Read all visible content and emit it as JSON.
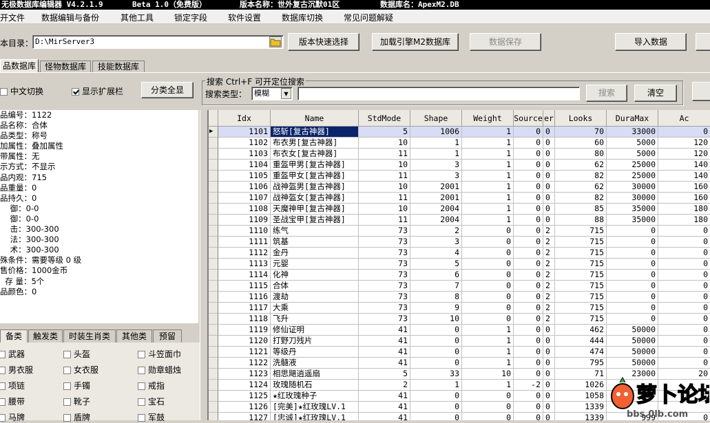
{
  "title": {
    "app": "无极数据库编辑器 V4.2.1.9",
    "edition": "Beta 1.0（免费版）",
    "version_label": "版本名称：世外复古沉默01区",
    "db_label": "数据库名：ApexM2.DB"
  },
  "menu": [
    "开文件",
    "数据编辑与备份",
    "其他工具",
    "锁定字段",
    "软件设置",
    "数据库切换",
    "常见问题解疑"
  ],
  "toolbar": {
    "dir_label": "本目录：",
    "dir_value": "D:\\MirServer3",
    "quick_select": "版本快速选择",
    "load_engine": "加载引擎M2数据库",
    "save_data": "数据保存",
    "import_data": "导入数据"
  },
  "db_tabs": [
    "品数据库",
    "怪物数据库",
    "技能数据库"
  ],
  "options": {
    "chinese_toggle": "中文切换",
    "show_ext": "显示扩展栏",
    "category_all": "分类全显"
  },
  "search": {
    "title": "搜索  Ctrl+F 可开定位搜索",
    "type_label": "搜索类型：",
    "type_value": "模糊",
    "search_btn": "搜索",
    "clear_btn": "清空"
  },
  "info": [
    "品编号：1122",
    "品名称：合体",
    "品类型：称号",
    "加属性：叠加属性",
    "带属性：无",
    "示方式：不显示",
    "品内观：715",
    "品重量：0",
    "品持久：0",
    "    御：0-0",
    "    御：0-0",
    "    击：300-300",
    "    法：300-300",
    "    术：300-300",
    "殊条件：需要等级 0 级",
    "售价格：1000金币",
    "  存 量：5个",
    "品颜色：0"
  ],
  "category_tabs": [
    "备类",
    "触发类",
    "时装生肖类",
    "其他类",
    "预留"
  ],
  "categories": [
    [
      "武器",
      "头盔",
      "斗笠面巾"
    ],
    [
      "男衣服",
      "女衣服",
      "勋章蜡烛"
    ],
    [
      "项链",
      "手镯",
      "戒指"
    ],
    [
      "腰带",
      "靴子",
      "宝石"
    ],
    [
      "马牌",
      "盾牌",
      "军鼓"
    ]
  ],
  "columns": [
    "Idx",
    "Name",
    "StdMode",
    "Shape",
    "Weight",
    "Source",
    "er",
    "Looks",
    "DuraMax",
    "Ac"
  ],
  "rows": [
    [
      "1101",
      "怒斩[复古神器]",
      "5",
      "1006",
      "1",
      "0",
      "0",
      "70",
      "33000",
      "0"
    ],
    [
      "1102",
      "布衣男[复古神器]",
      "10",
      "1",
      "1",
      "0",
      "0",
      "60",
      "5000",
      "120"
    ],
    [
      "1103",
      "布衣女[复古神器]",
      "11",
      "1",
      "1",
      "0",
      "0",
      "80",
      "5000",
      "120"
    ],
    [
      "1104",
      "重盔甲男[复古神器]",
      "10",
      "3",
      "1",
      "0",
      "0",
      "62",
      "25000",
      "140"
    ],
    [
      "1105",
      "重盔甲女[复古神器]",
      "11",
      "3",
      "1",
      "0",
      "0",
      "82",
      "25000",
      "140"
    ],
    [
      "1106",
      "战神盔男[复古神器]",
      "10",
      "2001",
      "1",
      "0",
      "0",
      "62",
      "30000",
      "160"
    ],
    [
      "1107",
      "战神盔女[复古神器]",
      "11",
      "2001",
      "1",
      "0",
      "0",
      "82",
      "30000",
      "160"
    ],
    [
      "1108",
      "天魔神甲[复古神器]",
      "10",
      "2004",
      "1",
      "0",
      "0",
      "85",
      "35000",
      "180"
    ],
    [
      "1109",
      "圣战宝甲[复古神器]",
      "11",
      "2004",
      "1",
      "0",
      "0",
      "88",
      "35000",
      "180"
    ],
    [
      "1110",
      "练气",
      "73",
      "2",
      "0",
      "0",
      "2",
      "715",
      "0",
      "0"
    ],
    [
      "1111",
      "筑基",
      "73",
      "3",
      "0",
      "0",
      "2",
      "715",
      "0",
      "0"
    ],
    [
      "1112",
      "金丹",
      "73",
      "4",
      "0",
      "0",
      "2",
      "715",
      "0",
      "0"
    ],
    [
      "1113",
      "元婴",
      "73",
      "5",
      "0",
      "0",
      "2",
      "715",
      "0",
      "0"
    ],
    [
      "1114",
      "化神",
      "73",
      "6",
      "0",
      "0",
      "2",
      "715",
      "0",
      "0"
    ],
    [
      "1115",
      "合体",
      "73",
      "7",
      "0",
      "0",
      "2",
      "715",
      "0",
      "0"
    ],
    [
      "1116",
      "渡劫",
      "73",
      "8",
      "0",
      "0",
      "2",
      "715",
      "0",
      "0"
    ],
    [
      "1117",
      "大乘",
      "73",
      "9",
      "0",
      "0",
      "2",
      "715",
      "0",
      "0"
    ],
    [
      "1118",
      "飞升",
      "73",
      "10",
      "0",
      "0",
      "2",
      "715",
      "0",
      "0"
    ],
    [
      "1119",
      "修仙证明",
      "41",
      "0",
      "1",
      "0",
      "0",
      "462",
      "50000",
      "0"
    ],
    [
      "1120",
      "打野刀残片",
      "41",
      "0",
      "1",
      "0",
      "0",
      "444",
      "50000",
      "0"
    ],
    [
      "1121",
      "等级丹",
      "41",
      "0",
      "1",
      "0",
      "0",
      "474",
      "50000",
      "0"
    ],
    [
      "1122",
      "洗髓液",
      "41",
      "0",
      "1",
      "0",
      "0",
      "795",
      "50000",
      "0"
    ],
    [
      "1123",
      "相思飓逍遥扇",
      "5",
      "33",
      "10",
      "0",
      "0",
      "71",
      "23000",
      "20"
    ],
    [
      "1124",
      "玫瑰随机石",
      "2",
      "1",
      "1",
      "-2",
      "0",
      "1026",
      "",
      ""
    ],
    [
      "1125",
      "★红玫瑰种子",
      "41",
      "0",
      "0",
      "0",
      "0",
      "1058",
      "",
      ""
    ],
    [
      "1126",
      "[完美]★红玫瑰LV.1",
      "41",
      "0",
      "0",
      "0",
      "0",
      "1339",
      "",
      ""
    ],
    [
      "1127",
      "[忠诚]★红玫瑰LV.1",
      "41",
      "0",
      "0",
      "0",
      "0",
      "1339",
      "999",
      "0"
    ]
  ],
  "watermark": {
    "brand": "萝卜论坛",
    "url": "bbs.0lb.com"
  }
}
